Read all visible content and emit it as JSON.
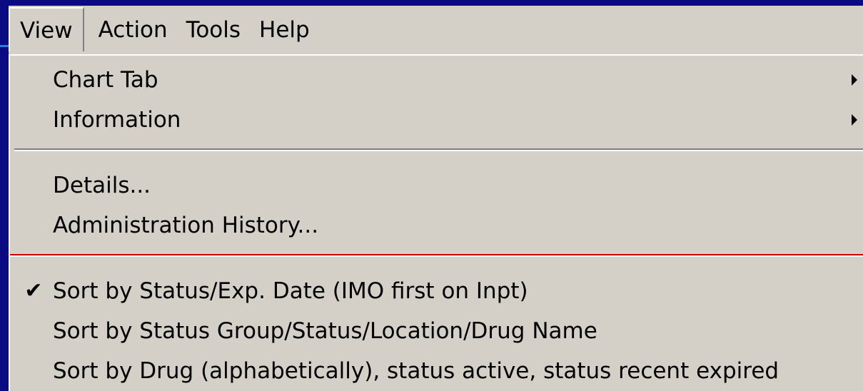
{
  "menubar": {
    "items": [
      {
        "label": "View"
      },
      {
        "label": "Action"
      },
      {
        "label": "Tools"
      },
      {
        "label": "Help"
      }
    ]
  },
  "menu": {
    "items": [
      {
        "label": "Chart Tab",
        "has_submenu": true,
        "checked": false
      },
      {
        "label": "Information",
        "has_submenu": true,
        "checked": false
      },
      {
        "label": "Details...",
        "has_submenu": false,
        "checked": false
      },
      {
        "label": "Administration History...",
        "has_submenu": false,
        "checked": false
      },
      {
        "label": "Sort by Status/Exp. Date (IMO first on Inpt)",
        "has_submenu": false,
        "checked": true
      },
      {
        "label": "Sort by Status Group/Status/Location/Drug Name",
        "has_submenu": false,
        "checked": false
      },
      {
        "label": "Sort by Drug (alphabetically), status active, status recent expired",
        "has_submenu": false,
        "checked": false
      }
    ],
    "check_glyph": "✔"
  },
  "colors": {
    "menu_bg": "#d4d0c8",
    "frame_blue": "#0a0a82",
    "separator_highlight": "#d00000"
  }
}
